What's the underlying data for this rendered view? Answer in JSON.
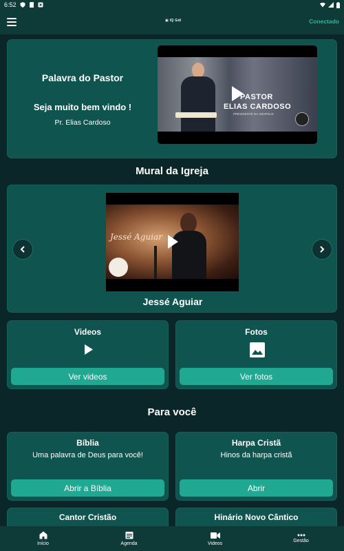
{
  "status_bar": {
    "time": "6:52"
  },
  "app_bar": {
    "logo_text": "▣ IQ Gdi",
    "connection_status": "Conectado"
  },
  "pastor_section": {
    "title": "Palavra do Pastor",
    "welcome": "Seja muito bem vindo !",
    "pastor_name": "Pr. Elias Cardoso",
    "video_overlay_line1": "PASTOR",
    "video_overlay_line2": "ELIAS CARDOSO",
    "video_overlay_line3": "PRESIDENTE DA ADHPSUS"
  },
  "mural": {
    "title": "Mural da Igreja",
    "video_caption": "Jessé Aguiar",
    "video_overlay_name": "Jessé Aguiar"
  },
  "media_cards": [
    {
      "title": "Videos",
      "icon": "play-icon",
      "button": "Ver videos"
    },
    {
      "title": "Fotos",
      "icon": "image-icon",
      "button": "Ver fotos"
    }
  ],
  "for_you": {
    "title": "Para você",
    "cards": [
      {
        "title": "Bíblia",
        "subtitle": "Uma palavra de Deus para você!",
        "button": "Abrir a Bíblia"
      },
      {
        "title": "Harpa Cristã",
        "subtitle": "Hinos da harpa cristã",
        "button": "Abrir"
      },
      {
        "title": "Cantor Cristão"
      },
      {
        "title": "Hinário Novo Cântico"
      }
    ]
  },
  "bottom_nav": [
    {
      "label": "Início",
      "icon": "home-icon"
    },
    {
      "label": "Agenda",
      "icon": "calendar-icon"
    },
    {
      "label": "Videos",
      "icon": "video-camera-icon"
    },
    {
      "label": "Gestão",
      "icon": "more-horizontal-icon"
    }
  ],
  "colors": {
    "background": "#0b2628",
    "card": "#105450",
    "bar": "#0e3a38",
    "accent": "#21a893",
    "connected": "#29b7a0"
  }
}
